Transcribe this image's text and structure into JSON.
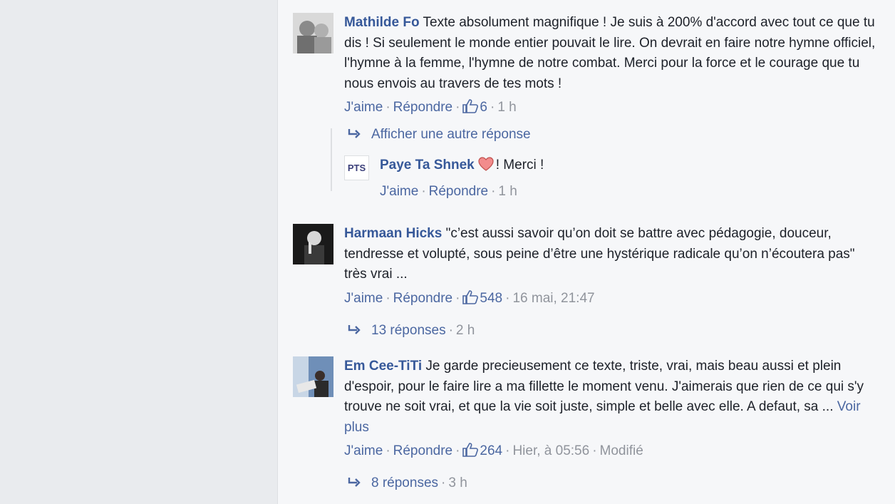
{
  "comments": [
    {
      "author": "Mathilde Fo",
      "text": "Texte absolument magnifique ! Je suis à 200% d'accord avec tout ce que tu dis ! Si seulement le monde entier pouvait le lire. On devrait en faire notre hymne officiel, l'hymne à la femme, l'hymne de notre combat. Merci pour la force et le courage que tu nous envois au travers de tes mots !",
      "like_label": "J'aime",
      "reply_label": "Répondre",
      "like_count": "6",
      "time": "1 h",
      "more_replies_label": "Afficher une autre réponse",
      "reply": {
        "author": "Paye Ta Shnek",
        "avatar_text": "PTS",
        "text": "! Merci !",
        "like_label": "J'aime",
        "reply_label": "Répondre",
        "time": "1 h"
      }
    },
    {
      "author": "Harmaan Hicks",
      "text": "\"c’est aussi savoir qu’on doit se battre avec pédagogie, douceur, tendresse et volupté, sous peine d’être une hystérique radicale qu’on n’écoutera pas\" très vrai ...",
      "like_label": "J'aime",
      "reply_label": "Répondre",
      "like_count": "548",
      "time": "16 mai, 21:47",
      "replies_label": "13 réponses",
      "replies_time": "2 h"
    },
    {
      "author": "Em Cee-TiTi",
      "text": "Je garde precieusement ce texte, triste, vrai, mais beau aussi et plein d'espoir, pour le faire lire a ma fillette le moment venu. J'aimerais que rien de ce qui s'y trouve ne soit vrai, et que la vie soit juste, simple et belle avec elle. A defaut, sa ...",
      "see_more_label": "Voir plus",
      "like_label": "J'aime",
      "reply_label": "Répondre",
      "like_count": "264",
      "time": "Hier, à 05:56",
      "edited_label": "Modifié",
      "replies_label": "8 réponses",
      "replies_time": "3 h"
    }
  ],
  "colors": {
    "link": "#365899",
    "meta": "#90949c",
    "page_bg": "#f6f7f9",
    "left_panel_bg": "#e9ebee"
  }
}
